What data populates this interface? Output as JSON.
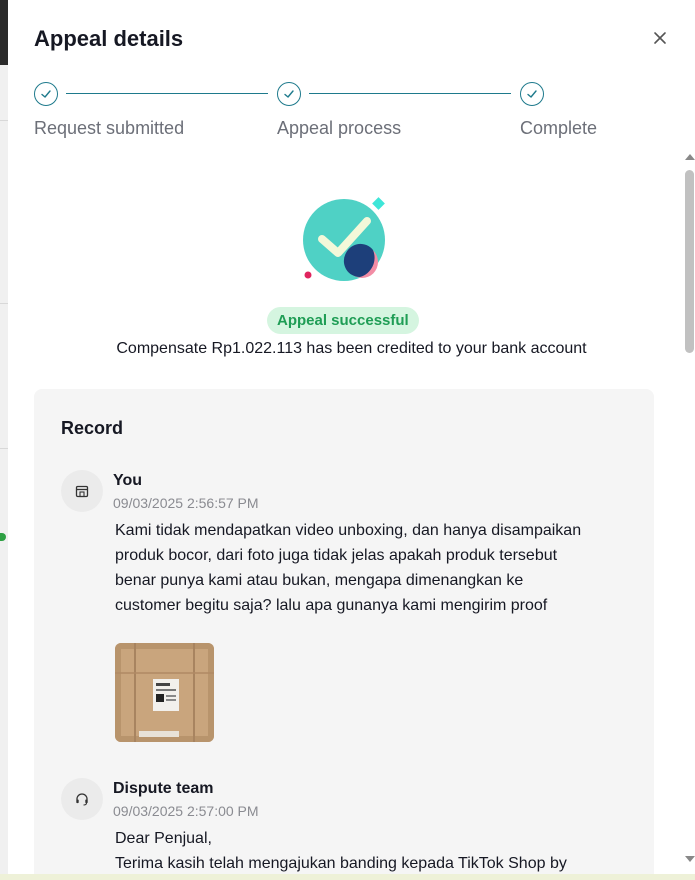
{
  "dialog": {
    "title": "Appeal details",
    "close_icon": "close-icon"
  },
  "stepper": {
    "steps": [
      {
        "label": "Request submitted",
        "status": "done"
      },
      {
        "label": "Appeal process",
        "status": "done"
      },
      {
        "label": "Complete",
        "status": "done"
      }
    ],
    "accent_color": "#1e7a8c"
  },
  "result": {
    "illustration_icon": "success-check-illustration",
    "badge": "Appeal successful",
    "message": "Compensate Rp1.022.113 has been credited to your bank account",
    "badge_bg": "#d5f5e0",
    "badge_color": "#1f9d55"
  },
  "record": {
    "title": "Record",
    "entries": [
      {
        "author": "You",
        "avatar_icon": "store-icon",
        "timestamp": "09/03/2025 2:56:57 PM",
        "message": "Kami tidak mendapatkan video unboxing, dan hanya disampaikan produk bocor, dari foto juga tidak jelas apakah produk tersebut benar punya kami atau bukan, mengapa dimenangkan ke customer begitu saja? lalu apa gunanya kami mengirim proof",
        "attachment": "package-photo-thumbnail"
      },
      {
        "author": "Dispute team",
        "avatar_icon": "headset-icon",
        "timestamp": "09/03/2025 2:57:00 PM",
        "message_line1": "Dear Penjual,",
        "message_line2": "Terima kasih telah mengajukan banding kepada TikTok Shop by"
      }
    ]
  }
}
